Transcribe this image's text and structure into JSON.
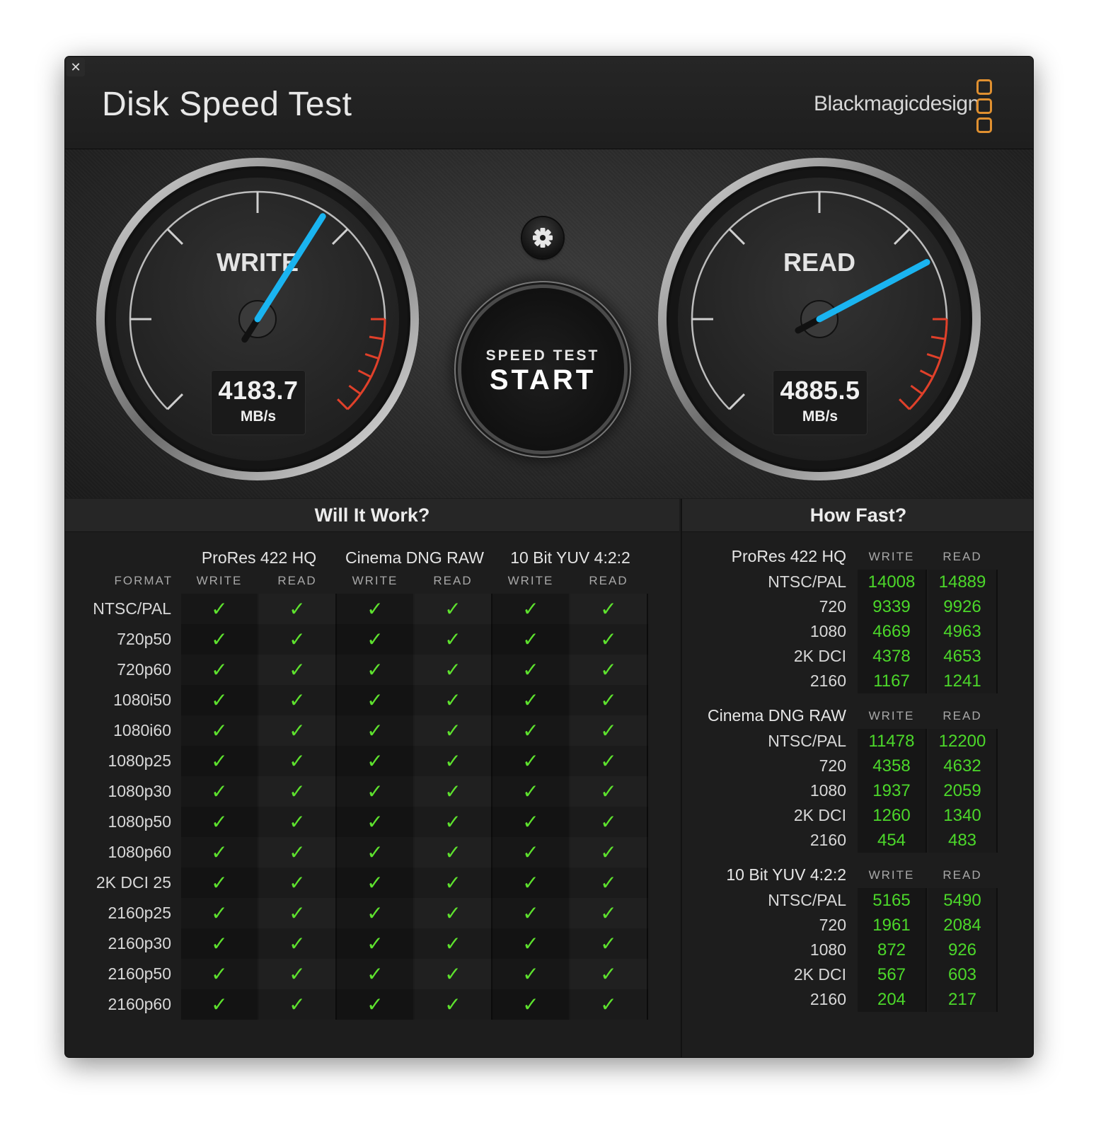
{
  "window": {
    "close_label": "✕",
    "title": "Disk Speed Test",
    "brand": "Blackmagicdesign",
    "brand_color": "#e09030"
  },
  "gauges": {
    "write": {
      "label": "WRITE",
      "value": "4183.7",
      "unit": "MB/s",
      "needle_fraction": 0.62
    },
    "read": {
      "label": "READ",
      "value": "4885.5",
      "unit": "MB/s",
      "needle_fraction": 0.73
    },
    "needle_color": "#1ab4f0",
    "redline_color": "#e0402a"
  },
  "controls": {
    "settings_icon": "gear-icon",
    "start_top": "SPEED TEST",
    "start_main": "START"
  },
  "will_it_work": {
    "title": "Will It Work?",
    "format_header": "FORMAT",
    "check_glyph": "✓",
    "groups": [
      {
        "name": "ProRes 422 HQ",
        "write": "WRITE",
        "read": "READ"
      },
      {
        "name": "Cinema DNG RAW",
        "write": "WRITE",
        "read": "READ"
      },
      {
        "name": "10 Bit YUV 4:2:2",
        "write": "WRITE",
        "read": "READ"
      }
    ],
    "formats": [
      "NTSC/PAL",
      "720p50",
      "720p60",
      "1080i50",
      "1080i60",
      "1080p25",
      "1080p30",
      "1080p50",
      "1080p60",
      "2K DCI 25",
      "2160p25",
      "2160p30",
      "2160p50",
      "2160p60"
    ],
    "status": "all-pass"
  },
  "how_fast": {
    "title": "How Fast?",
    "write_header": "WRITE",
    "read_header": "READ",
    "sections": [
      {
        "name": "ProRes 422 HQ",
        "rows": [
          {
            "label": "NTSC/PAL",
            "write": "14008",
            "read": "14889"
          },
          {
            "label": "720",
            "write": "9339",
            "read": "9926"
          },
          {
            "label": "1080",
            "write": "4669",
            "read": "4963"
          },
          {
            "label": "2K DCI",
            "write": "4378",
            "read": "4653"
          },
          {
            "label": "2160",
            "write": "1167",
            "read": "1241"
          }
        ]
      },
      {
        "name": "Cinema DNG RAW",
        "rows": [
          {
            "label": "NTSC/PAL",
            "write": "11478",
            "read": "12200"
          },
          {
            "label": "720",
            "write": "4358",
            "read": "4632"
          },
          {
            "label": "1080",
            "write": "1937",
            "read": "2059"
          },
          {
            "label": "2K DCI",
            "write": "1260",
            "read": "1340"
          },
          {
            "label": "2160",
            "write": "454",
            "read": "483"
          }
        ]
      },
      {
        "name": "10 Bit YUV 4:2:2",
        "rows": [
          {
            "label": "NTSC/PAL",
            "write": "5165",
            "read": "5490"
          },
          {
            "label": "720",
            "write": "1961",
            "read": "2084"
          },
          {
            "label": "1080",
            "write": "872",
            "read": "926"
          },
          {
            "label": "2K DCI",
            "write": "567",
            "read": "603"
          },
          {
            "label": "2160",
            "write": "204",
            "read": "217"
          }
        ]
      }
    ]
  }
}
